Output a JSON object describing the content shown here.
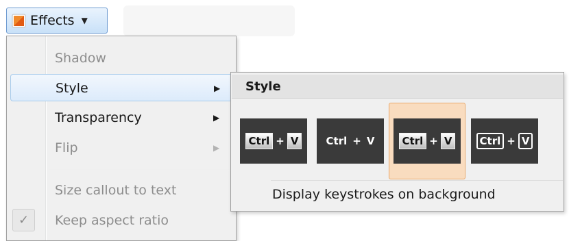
{
  "toolbar": {
    "effects_label": "Effects",
    "effects_icon": "effects-square-icon",
    "chevron_icon": "chevron-down-icon"
  },
  "menu": {
    "items": [
      {
        "label": "Shadow",
        "enabled": false,
        "submenu": false
      },
      {
        "label": "Style",
        "enabled": true,
        "submenu": true,
        "highlighted": true
      },
      {
        "label": "Transparency",
        "enabled": true,
        "submenu": true
      },
      {
        "label": "Flip",
        "enabled": false,
        "submenu": true
      },
      {
        "label": "Size callout to text",
        "enabled": false,
        "submenu": false
      },
      {
        "label": "Keep aspect ratio",
        "enabled": false,
        "submenu": false,
        "checked": true
      }
    ],
    "arrow": "▶",
    "check": "✓"
  },
  "submenu": {
    "title": "Style",
    "caption": "Display keystrokes on background",
    "tiles": [
      {
        "key1": "Ctrl",
        "plus": "+",
        "key2": "V",
        "style": "raised-keys"
      },
      {
        "key1": "Ctrl",
        "plus": "+",
        "key2": "V",
        "style": "plain-text"
      },
      {
        "key1": "Ctrl",
        "plus": "+",
        "key2": "V",
        "style": "raised-keys",
        "selected": true
      },
      {
        "key1": "Ctrl",
        "plus": "+",
        "key2": "V",
        "style": "outlined-keys"
      }
    ]
  },
  "colors": {
    "menu_bg": "#f0f0f0",
    "hover_border": "#a8cbeb",
    "selected_tile_bg": "#f9dcbf",
    "selected_tile_border": "#e9a86a",
    "tile_bg": "#3a3a3a"
  }
}
